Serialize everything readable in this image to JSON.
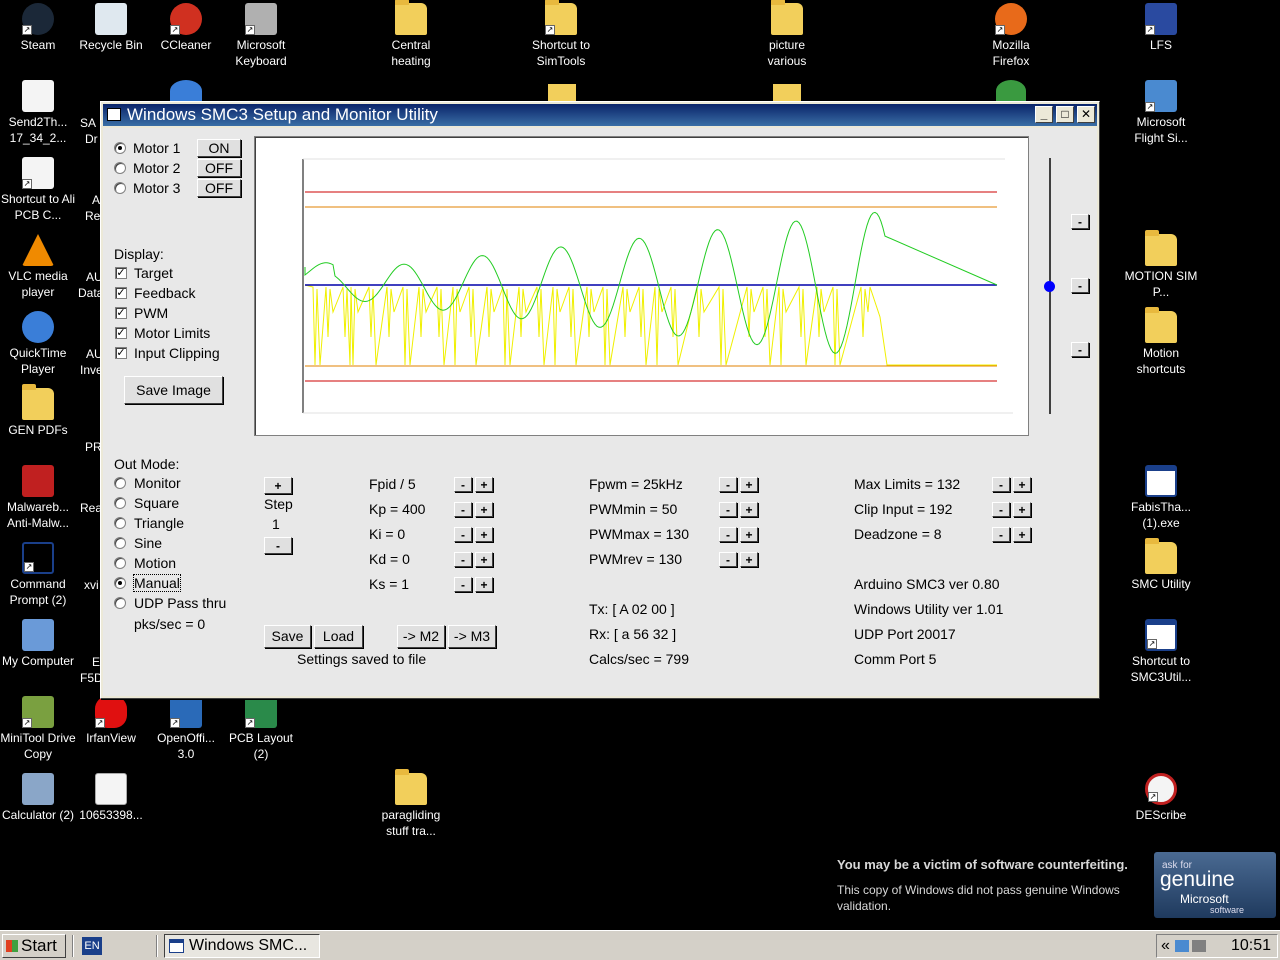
{
  "desktop": {
    "icons": [
      {
        "label": "Steam",
        "x": 0,
        "y": 0
      },
      {
        "label": "Recycle Bin"
      },
      {
        "label": "CCleaner"
      },
      {
        "label": "Microsoft Keyboard"
      },
      {
        "label": "Central heating"
      },
      {
        "label": "Shortcut to SimTools"
      },
      {
        "label": "picture various"
      },
      {
        "label": "Mozilla Firefox"
      },
      {
        "label": "LFS"
      },
      {
        "label": "Send2Th... 17_34_2..."
      },
      {
        "label": "Microsoft Flight Si..."
      },
      {
        "label": "Shortcut to Ali PCB C..."
      },
      {
        "label": "VLC media player"
      },
      {
        "label": "MOTION SIM P..."
      },
      {
        "label": "QuickTime Player"
      },
      {
        "label": "Motion shortcuts"
      },
      {
        "label": "GEN PDFs"
      },
      {
        "label": "Malwareb... Anti-Malw..."
      },
      {
        "label": "FabisTha... (1).exe"
      },
      {
        "label": "Command Prompt (2)"
      },
      {
        "label": "SMC Utility"
      },
      {
        "label": "My Computer"
      },
      {
        "label": "Shortcut to SMC3Util..."
      },
      {
        "label": "MiniTool Drive Copy"
      },
      {
        "label": "IrfanView"
      },
      {
        "label": "OpenOffi... 3.0"
      },
      {
        "label": "PCB Layout (2)"
      },
      {
        "label": "Calculator (2)"
      },
      {
        "label": "10653398..."
      },
      {
        "label": "paragliding stuff tra..."
      },
      {
        "label": "DEScribe"
      }
    ],
    "partial_labels": [
      "SA",
      "Dr",
      "A",
      "Re",
      "AU",
      "Data",
      "AU",
      "Inve",
      "PR",
      "Rea",
      "xvi",
      "E",
      "F5D"
    ]
  },
  "window": {
    "title": "Windows SMC3 Setup and Monitor Utility",
    "motors": [
      {
        "label": "Motor 1",
        "state": "ON",
        "selected": true
      },
      {
        "label": "Motor 2",
        "state": "OFF",
        "selected": false
      },
      {
        "label": "Motor 3",
        "state": "OFF",
        "selected": false
      }
    ],
    "display": {
      "heading": "Display:",
      "options": [
        "Target",
        "Feedback",
        "PWM",
        "Motor Limits",
        "Input Clipping"
      ]
    },
    "save_image": "Save Image",
    "out_mode": {
      "heading": "Out Mode:",
      "options": [
        "Monitor",
        "Square",
        "Triangle",
        "Sine",
        "Motion",
        "Manual",
        "UDP Pass thru"
      ],
      "selected": "Manual",
      "pks": "pks/sec = 0"
    },
    "step": {
      "plus": "+",
      "label": "Step",
      "value": "1",
      "minus": "-"
    },
    "pid": [
      "Fpid / 5",
      "Kp = 400",
      "Ki = 0",
      "Kd = 0",
      "Ks = 1"
    ],
    "pwm": [
      "Fpwm = 25kHz",
      "PWMmin = 50",
      "PWMmax = 130",
      "PWMrev = 130"
    ],
    "limits": [
      "Max Limits = 132",
      "Clip Input = 192",
      "Deadzone = 8"
    ],
    "comm": {
      "tx": "Tx: [ A 02 00 ]",
      "rx": "Rx: [ a 56 32 ]",
      "calcs": "Calcs/sec = 799"
    },
    "info": [
      "Arduino SMC3 ver 0.80",
      "Windows Utility ver 1.01",
      "UDP Port 20017",
      "Comm Port 5"
    ],
    "buttons": {
      "save": "Save",
      "load": "Load",
      "m2": "-> M2",
      "m3": "-> M3",
      "minus": "-",
      "plus": "+"
    },
    "status": "Settings saved to file",
    "slider_buttons": [
      "-",
      "-",
      "-"
    ]
  },
  "genuine": {
    "headline": "You may be a victim of software counterfeiting.",
    "body": "This copy of Windows did not pass genuine Windows validation.",
    "badge_top": "ask for",
    "badge_main": "genuine",
    "badge_brand": "Microsoft",
    "badge_sub": "software"
  },
  "taskbar": {
    "start": "Start",
    "lang": "EN",
    "task": "Windows SMC...",
    "chevron": "«",
    "clock": "10:51"
  },
  "colors": {
    "limit_red": "#cc0000",
    "clip_orange": "#e08000",
    "target_blue": "#0000aa",
    "feedback_green": "#22cc22",
    "pwm_yellow": "#f0f000"
  }
}
